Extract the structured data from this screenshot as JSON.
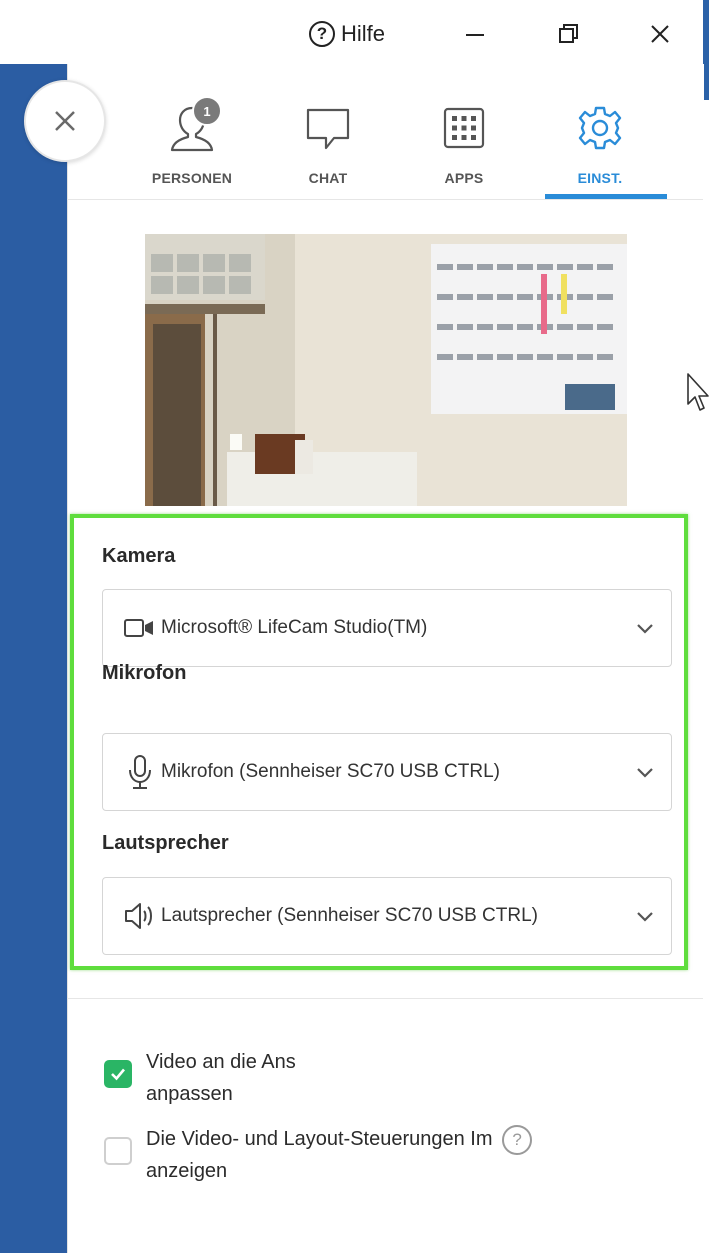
{
  "titlebar": {
    "help_label": "Hilfe",
    "help_icon": "?"
  },
  "tabs": [
    {
      "label": "PERSONEN",
      "icon": "person-icon",
      "badge": "1"
    },
    {
      "label": "CHAT",
      "icon": "chat-bubble-icon"
    },
    {
      "label": "APPS",
      "icon": "apps-grid-icon"
    },
    {
      "label": "EINST.",
      "icon": "gear-icon",
      "active": true
    }
  ],
  "devices": {
    "camera": {
      "label": "Kamera",
      "value": "Microsoft® LifeCam Studio(TM)"
    },
    "microphone": {
      "label": "Mikrofon",
      "value": "Mikrofon (Sennheiser SC70 USB CTRL)"
    },
    "speaker": {
      "label": "Lautsprecher",
      "value": "Lautsprecher (Sennheiser SC70 USB CTRL)"
    }
  },
  "options": {
    "fit_video": {
      "line1": "Video an die Ans",
      "line2": "anpassen",
      "checked": true
    },
    "show_controls": {
      "line1": "Die Video- und Layout-Steuerungen Im",
      "line2": "anzeigen",
      "help_icon": "?",
      "checked": false
    }
  },
  "colors": {
    "accent": "#2a8cd8",
    "sidebar_blue": "#2b5da3",
    "highlight_green": "#5fdd3d",
    "checkbox_green": "#2ab565"
  }
}
